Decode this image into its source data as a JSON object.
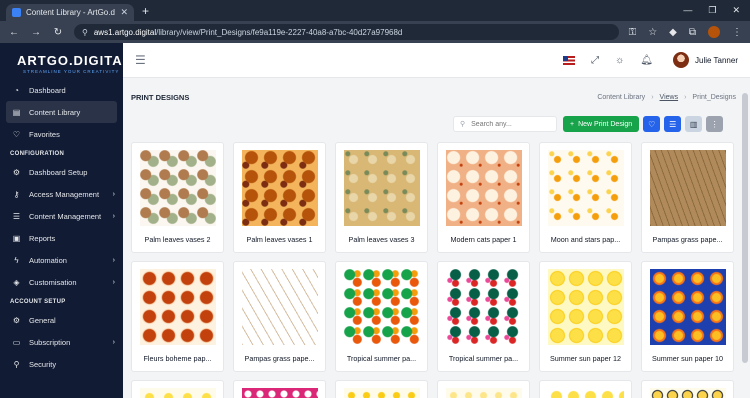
{
  "browser": {
    "tab_title": "Content Library - ArtGo.digital",
    "url_host": "aws1.artgo.digital",
    "url_path": "/library/view/Print_Designs/fe9a119e-2227-40a8-a7bc-40d27a97968d"
  },
  "sidebar": {
    "brand": "ARTGO.DIGITAL",
    "tagline": "STREAMLINE YOUR CREATIVITY",
    "items_top": [
      {
        "label": "Dashboard",
        "icon": "gauge-icon"
      },
      {
        "label": "Content Library",
        "icon": "library-icon",
        "active": true
      },
      {
        "label": "Favorites",
        "icon": "heart-icon"
      }
    ],
    "section_config": "CONFIGURATION",
    "items_config": [
      {
        "label": "Dashboard Setup",
        "icon": "gear-icon",
        "chevron": false
      },
      {
        "label": "Access Management",
        "icon": "key-icon",
        "chevron": true
      },
      {
        "label": "Content Management",
        "icon": "sliders-icon",
        "chevron": true
      },
      {
        "label": "Reports",
        "icon": "report-icon",
        "chevron": false
      },
      {
        "label": "Automation",
        "icon": "bolt-icon",
        "chevron": true
      },
      {
        "label": "Customisation",
        "icon": "cube-icon",
        "chevron": true
      }
    ],
    "section_account": "ACCOUNT SETUP",
    "items_account": [
      {
        "label": "General",
        "icon": "gear-icon"
      },
      {
        "label": "Subscription",
        "icon": "card-icon",
        "chevron": true
      },
      {
        "label": "Security",
        "icon": "search-icon"
      }
    ]
  },
  "header": {
    "user_name": "Julie Tanner"
  },
  "page": {
    "title": "PRINT DESIGNS",
    "breadcrumb": [
      "Content Library",
      "Views",
      "Print_Designs"
    ],
    "search_placeholder": "Search any...",
    "new_button": "New Print Design"
  },
  "cards": [
    {
      "caption": "Palm leaves vases 2",
      "pattern": "p-vases2"
    },
    {
      "caption": "Palm leaves vases 1",
      "pattern": "p-vases1"
    },
    {
      "caption": "Palm leaves vases 3",
      "pattern": "p-vases3"
    },
    {
      "caption": "Modern cats paper 1",
      "pattern": "p-cats"
    },
    {
      "caption": "Moon and stars pap...",
      "pattern": "p-moon"
    },
    {
      "caption": "Pampas grass pape...",
      "pattern": "p-pampas"
    },
    {
      "caption": "Fleurs boheme pap...",
      "pattern": "p-fleurs"
    },
    {
      "caption": "Pampas grass pape...",
      "pattern": "p-pampas2"
    },
    {
      "caption": "Tropical summer pa...",
      "pattern": "p-tropical"
    },
    {
      "caption": "Tropical summer pa...",
      "pattern": "p-tropical2"
    },
    {
      "caption": "Summer sun paper 12",
      "pattern": "p-sun12"
    },
    {
      "caption": "Summer sun paper 10",
      "pattern": "p-sun10"
    }
  ],
  "partial_cards": [
    "p-r3a",
    "p-r3b",
    "p-r3c",
    "p-r3d",
    "p-r3e",
    "p-r3f"
  ],
  "colors": {
    "sidebar_bg": "#111b33",
    "accent_green": "#16a34a",
    "accent_blue": "#2563eb"
  }
}
